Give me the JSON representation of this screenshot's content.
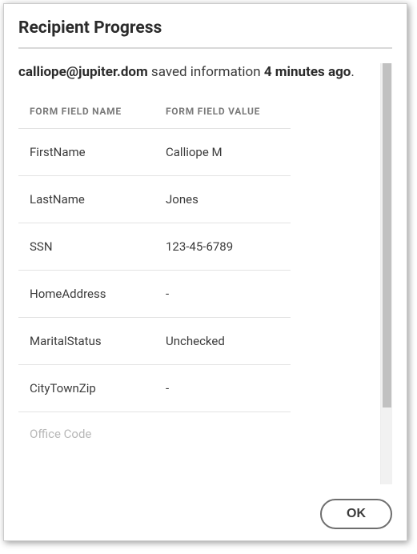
{
  "dialog": {
    "title": "Recipient Progress"
  },
  "status": {
    "email": "calliope@jupiter.dom",
    "mid": " saved information ",
    "time": "4 minutes ago",
    "end": "."
  },
  "table": {
    "header_name": "FORM FIELD NAME",
    "header_value": "FORM FIELD VALUE",
    "rows": [
      {
        "name": "FirstName",
        "value": "Calliope M"
      },
      {
        "name": "LastName",
        "value": "Jones"
      },
      {
        "name": "SSN",
        "value": "123-45-6789"
      },
      {
        "name": "HomeAddress",
        "value": "-"
      },
      {
        "name": "MaritalStatus",
        "value": "Unchecked"
      },
      {
        "name": "CityTownZip",
        "value": "-"
      }
    ],
    "partial_row_name": "Office Code"
  },
  "footer": {
    "ok_label": "OK"
  }
}
